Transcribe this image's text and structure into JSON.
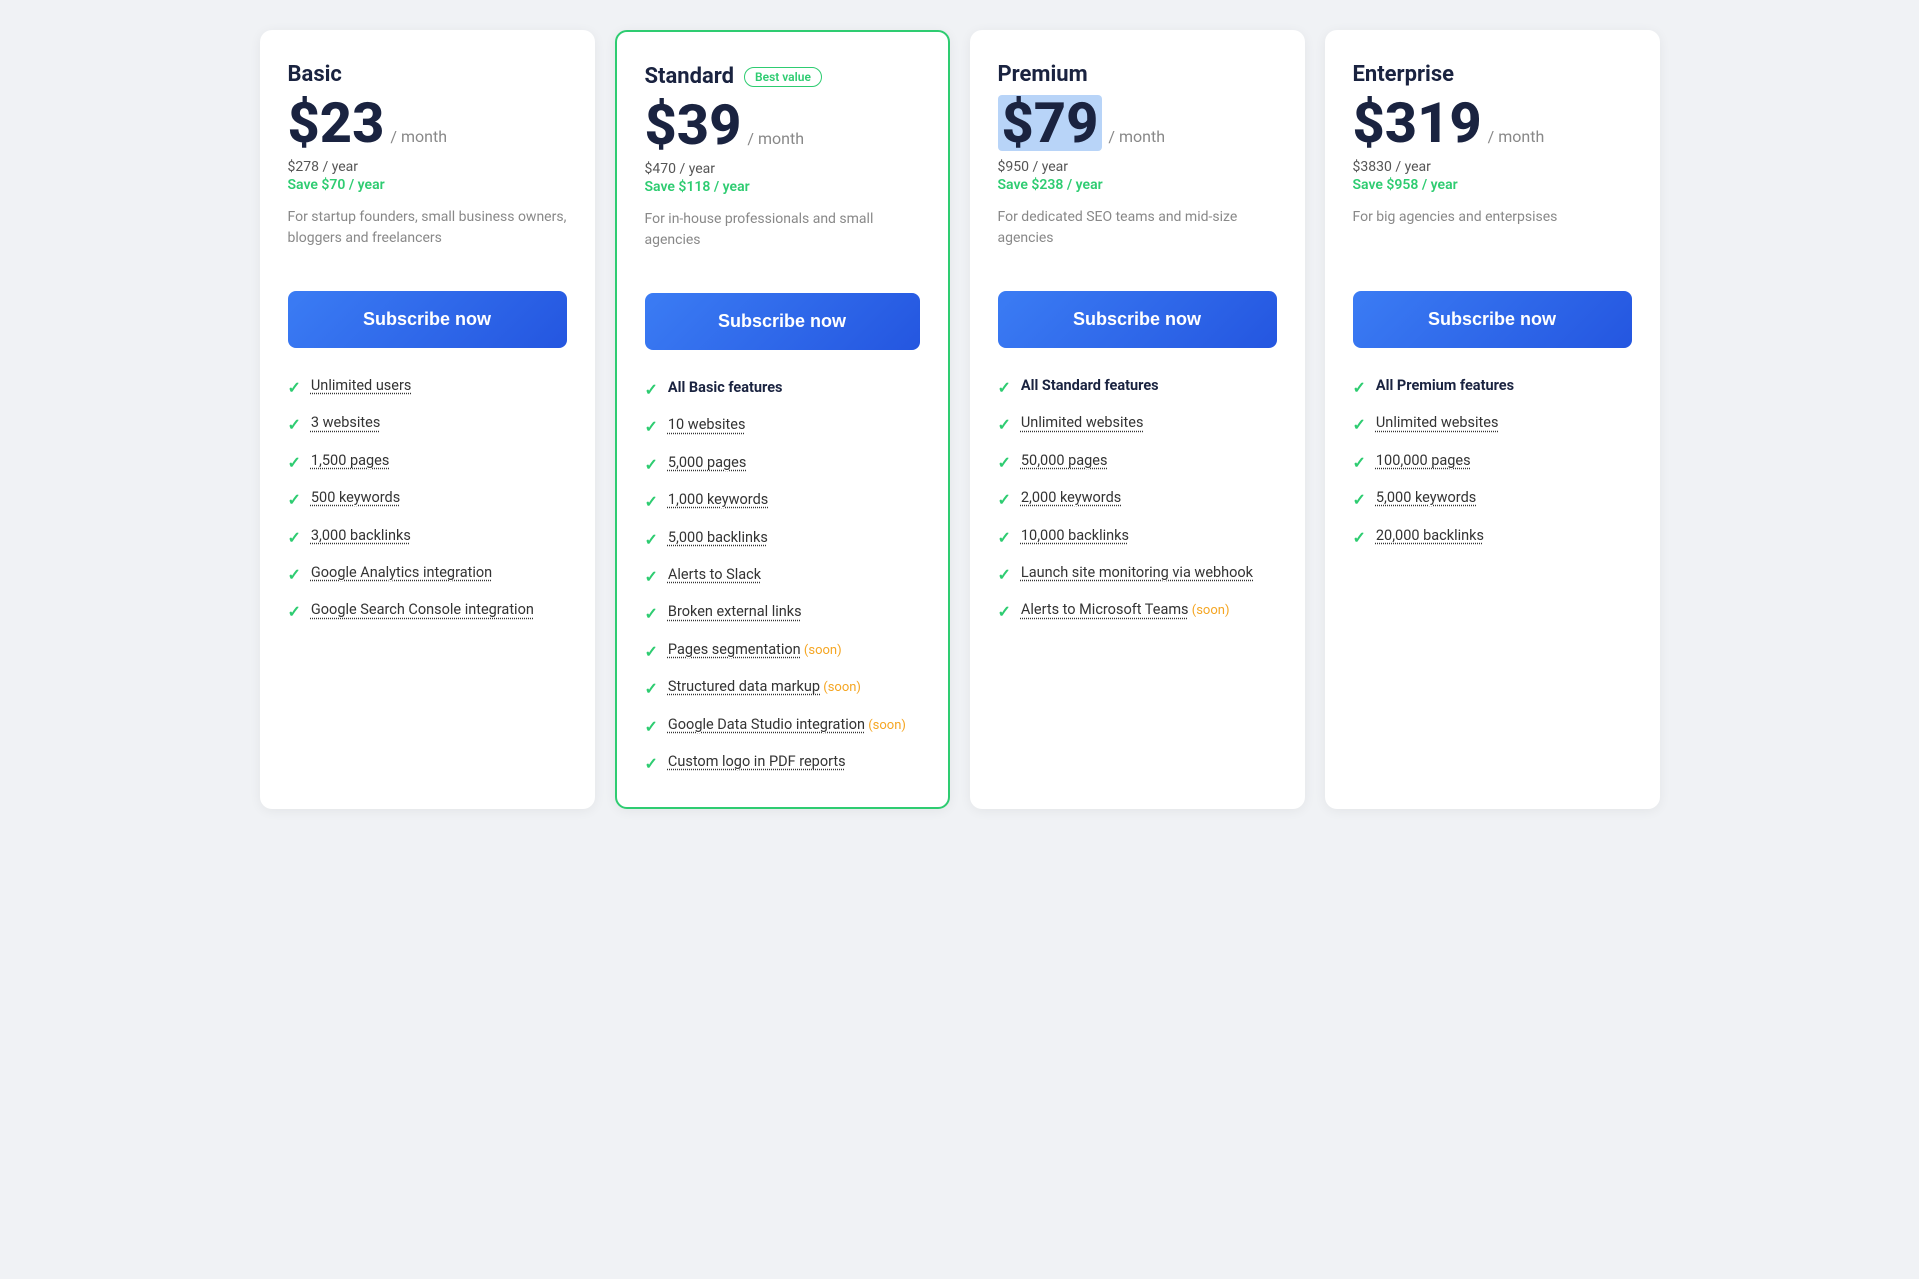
{
  "plans": [
    {
      "id": "basic",
      "name": "Basic",
      "featured": false,
      "badge": null,
      "price": "$23",
      "priceHighlight": false,
      "period": "/ month",
      "yearly": "$278 / year",
      "save": "Save $70 / year",
      "desc": "For startup founders, small business owners, bloggers and freelancers",
      "cta": "Subscribe now",
      "features": [
        {
          "text": "Unlimited users",
          "bold": false,
          "soon": false,
          "dotted": true
        },
        {
          "text": "3 websites",
          "bold": false,
          "soon": false,
          "dotted": true
        },
        {
          "text": "1,500 pages",
          "bold": false,
          "soon": false,
          "dotted": true
        },
        {
          "text": "500 keywords",
          "bold": false,
          "soon": false,
          "dotted": true
        },
        {
          "text": "3,000 backlinks",
          "bold": false,
          "soon": false,
          "dotted": true
        },
        {
          "text": "Google Analytics integration",
          "bold": false,
          "soon": false,
          "dotted": true
        },
        {
          "text": "Google Search Console integration",
          "bold": false,
          "soon": false,
          "dotted": true
        }
      ]
    },
    {
      "id": "standard",
      "name": "Standard",
      "featured": true,
      "badge": "Best value",
      "price": "$39",
      "priceHighlight": false,
      "period": "/ month",
      "yearly": "$470 / year",
      "save": "Save $118 / year",
      "desc": "For in-house professionals and small agencies",
      "cta": "Subscribe now",
      "features": [
        {
          "text": "All Basic features",
          "bold": true,
          "soon": false,
          "dotted": false
        },
        {
          "text": "10 websites",
          "bold": false,
          "soon": false,
          "dotted": true
        },
        {
          "text": "5,000 pages",
          "bold": false,
          "soon": false,
          "dotted": true
        },
        {
          "text": "1,000 keywords",
          "bold": false,
          "soon": false,
          "dotted": true
        },
        {
          "text": "5,000 backlinks",
          "bold": false,
          "soon": false,
          "dotted": true
        },
        {
          "text": "Alerts to Slack",
          "bold": false,
          "soon": false,
          "dotted": true
        },
        {
          "text": "Broken external links",
          "bold": false,
          "soon": false,
          "dotted": true
        },
        {
          "text": "Pages segmentation",
          "bold": false,
          "soon": true,
          "dotted": true
        },
        {
          "text": "Structured data markup",
          "bold": false,
          "soon": true,
          "dotted": true
        },
        {
          "text": "Google Data Studio integration",
          "bold": false,
          "soon": true,
          "dotted": true
        },
        {
          "text": "Custom logo in PDF reports",
          "bold": false,
          "soon": false,
          "dotted": true
        }
      ]
    },
    {
      "id": "premium",
      "name": "Premium",
      "featured": false,
      "badge": null,
      "price": "$79",
      "priceHighlight": true,
      "period": "/ month",
      "yearly": "$950 / year",
      "save": "Save $238 / year",
      "desc": "For dedicated SEO teams and mid-size agencies",
      "cta": "Subscribe now",
      "features": [
        {
          "text": "All Standard features",
          "bold": true,
          "soon": false,
          "dotted": false
        },
        {
          "text": "Unlimited websites",
          "bold": false,
          "soon": false,
          "dotted": true
        },
        {
          "text": "50,000 pages",
          "bold": false,
          "soon": false,
          "dotted": true
        },
        {
          "text": "2,000 keywords",
          "bold": false,
          "soon": false,
          "dotted": true
        },
        {
          "text": "10,000 backlinks",
          "bold": false,
          "soon": false,
          "dotted": true
        },
        {
          "text": "Launch site monitoring via webhook",
          "bold": false,
          "soon": false,
          "dotted": true
        },
        {
          "text": "Alerts to Microsoft Teams",
          "bold": false,
          "soon": true,
          "dotted": true
        }
      ]
    },
    {
      "id": "enterprise",
      "name": "Enterprise",
      "featured": false,
      "badge": null,
      "price": "$319",
      "priceHighlight": false,
      "period": "/ month",
      "yearly": "$3830 / year",
      "save": "Save $958 / year",
      "desc": "For big agencies and enterpsises",
      "cta": "Subscribe now",
      "features": [
        {
          "text": "All Premium features",
          "bold": true,
          "soon": false,
          "dotted": false
        },
        {
          "text": "Unlimited websites",
          "bold": false,
          "soon": false,
          "dotted": true
        },
        {
          "text": "100,000 pages",
          "bold": false,
          "soon": false,
          "dotted": true
        },
        {
          "text": "5,000 keywords",
          "bold": false,
          "soon": false,
          "dotted": true
        },
        {
          "text": "20,000 backlinks",
          "bold": false,
          "soon": false,
          "dotted": true
        }
      ]
    }
  ]
}
